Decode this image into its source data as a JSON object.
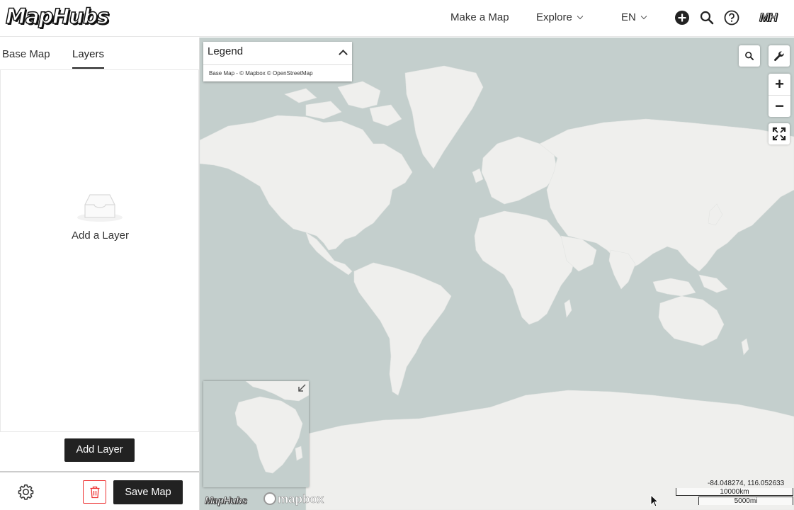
{
  "app": {
    "logo_text": "MapHubs",
    "user_badge": "MH"
  },
  "header": {
    "nav": [
      {
        "label": "Make a Map"
      },
      {
        "label": "Explore"
      },
      {
        "label": "EN"
      }
    ],
    "icons": [
      "add-circle-icon",
      "search-icon",
      "help-icon"
    ]
  },
  "sidebar": {
    "tabs": [
      {
        "label": "Base Map",
        "active": false
      },
      {
        "label": "Layers",
        "active": true
      }
    ],
    "empty_state": {
      "icon": "inbox-icon",
      "text": "Add a Layer"
    },
    "add_layer_label": "Add Layer",
    "save_label": "Save Map",
    "settings_icon": "gear-icon",
    "delete_icon": "trash-icon"
  },
  "map": {
    "legend": {
      "title": "Legend",
      "attribution": "Base Map - © Mapbox © OpenStreetMap"
    },
    "controls": [
      "search-icon",
      "wrench-icon",
      "zoom-in",
      "zoom-out",
      "fullscreen-icon"
    ],
    "zoom_in_label": "+",
    "zoom_out_label": "−",
    "coordinates": "-84.048274, 116.052633",
    "scale_km": "10000km",
    "scale_mi": "5000mi",
    "brand_left": "MapHubs",
    "brand_right": "mapbox",
    "colors": {
      "water": "#c4cfcd",
      "land": "#efefed"
    }
  }
}
